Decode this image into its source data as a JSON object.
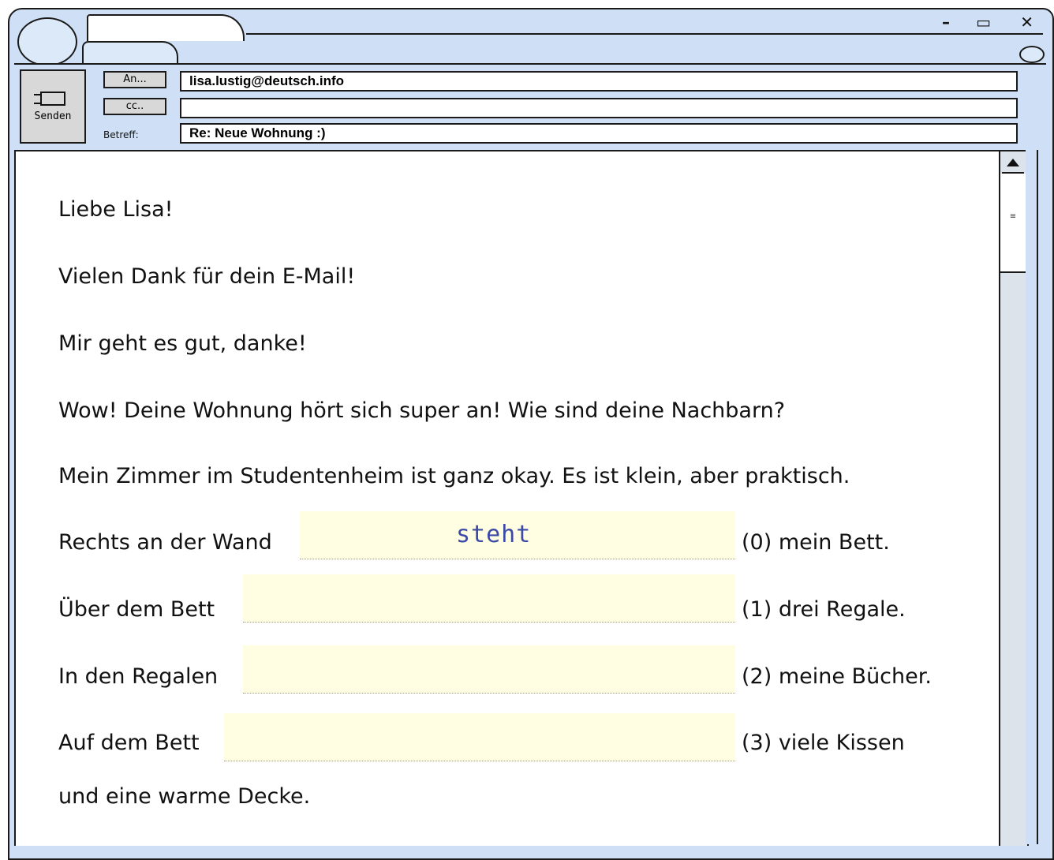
{
  "window": {
    "controls": [
      "–",
      "▭",
      "✕"
    ]
  },
  "compose": {
    "send_label": "Senden",
    "to_button": "An...",
    "cc_button": "cc..",
    "subject_label": "Betreff:",
    "to_value": "lisa.lustig@deutsch.info",
    "cc_value": "",
    "subject_value": "Re: Neue Wohnung :)"
  },
  "message": {
    "l1": "Liebe Lisa!",
    "l2": "Vielen Dank für dein E-Mail!",
    "l3": "Mir geht es gut, danke!",
    "l4": "Wow! Deine Wohnung hört sich super an! Wie sind deine Nachbarn?",
    "l5": "Mein Zimmer im Studentenheim ist ganz okay. Es ist klein, aber praktisch.",
    "gap0_pre": "Rechts an der Wand",
    "gap0_answer": "steht",
    "gap0_post": "(0) mein Bett.",
    "gap1_pre": "Über dem Bett",
    "gap1_answer": "",
    "gap1_post": "(1) drei Regale.",
    "gap2_pre": "In den Regalen",
    "gap2_answer": "",
    "gap2_post": "(2) meine Bücher.",
    "gap3_pre": "Auf dem Bett",
    "gap3_answer": "",
    "gap3_post": "(3) viele Kissen",
    "l_last": "und eine warme Decke."
  },
  "scrollbar": {
    "thumb_glyph": "≡"
  }
}
